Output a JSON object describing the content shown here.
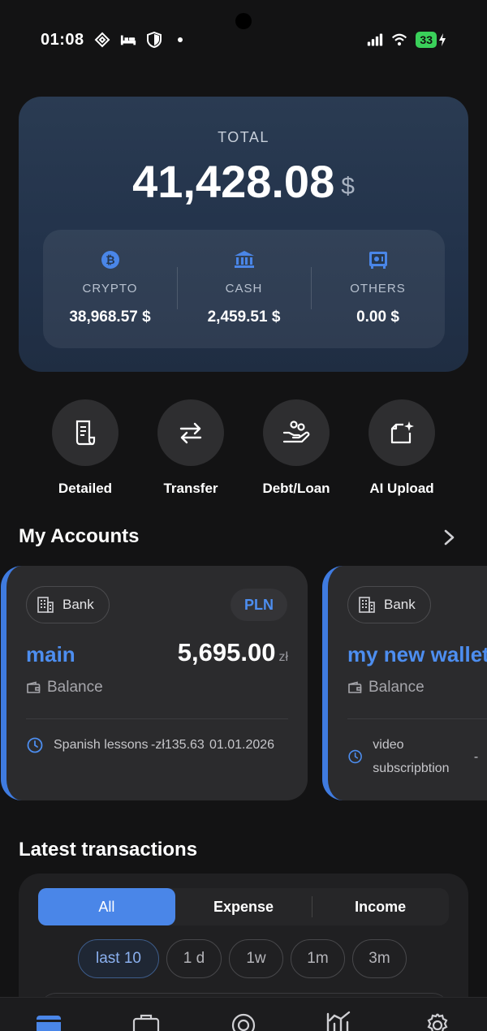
{
  "status": {
    "time": "01:08",
    "battery": "33"
  },
  "total": {
    "label": "TOTAL",
    "amount": "41,428.08",
    "currency": "$",
    "breakdown": [
      {
        "icon": "bitcoin-icon",
        "label": "CRYPTO",
        "value": "38,968.57 $"
      },
      {
        "icon": "bank-icon",
        "label": "CASH",
        "value": "2,459.51 $"
      },
      {
        "icon": "safe-icon",
        "label": "OTHERS",
        "value": "0.00 $"
      }
    ]
  },
  "actions": [
    {
      "icon": "receipt-icon",
      "label": "Detailed"
    },
    {
      "icon": "transfer-arrows-icon",
      "label": "Transfer"
    },
    {
      "icon": "hand-coins-icon",
      "label": "Debt/Loan"
    },
    {
      "icon": "ai-upload-icon",
      "label": "AI Upload"
    }
  ],
  "accounts": {
    "title": "My Accounts",
    "items": [
      {
        "type": "Bank",
        "currency_tag": "PLN",
        "name": "main",
        "amount": "5,695.00",
        "currency": "zł",
        "balance_label": "Balance",
        "last_tx": {
          "desc": "Spanish lessons",
          "amount": "-zł135.63",
          "date": "01.01.2026"
        }
      },
      {
        "type": "Bank",
        "currency_tag": "",
        "name": "my new wallet",
        "amount": "",
        "currency": "",
        "balance_label": "Balance",
        "last_tx": {
          "desc": "video subscripbtion",
          "amount": "-",
          "date": ""
        }
      }
    ]
  },
  "transactions": {
    "title": "Latest transactions",
    "filters": [
      "All",
      "Expense",
      "Income"
    ],
    "active_filter": "All",
    "periods": [
      "last 10",
      "1 d",
      "1w",
      "1m",
      "3m"
    ],
    "active_period": "last 10"
  },
  "colors": {
    "accent": "#4a86e8",
    "background": "#131314",
    "card": "#2b2b2d",
    "total_card": "#26374d"
  }
}
